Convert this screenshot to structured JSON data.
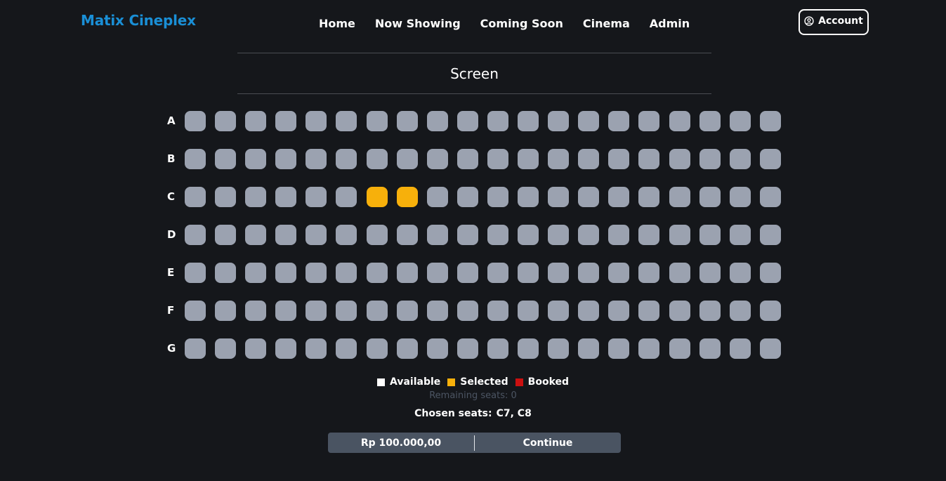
{
  "header": {
    "brand": "Matix Cineplex",
    "nav": [
      "Home",
      "Now Showing",
      "Coming Soon",
      "Cinema",
      "Admin"
    ],
    "account_label": "Account"
  },
  "screen_label": "Screen",
  "seats": {
    "rows": [
      "A",
      "B",
      "C",
      "D",
      "E",
      "F",
      "G"
    ],
    "seats_per_row": 20,
    "selected": [
      "C7",
      "C8"
    ],
    "booked": []
  },
  "legend": {
    "available": "Available",
    "selected": "Selected",
    "booked": "Booked",
    "colors": {
      "available": "#ffffff",
      "selected": "#f7b00b",
      "booked": "#cc1010",
      "seat": "#9ba2b0"
    }
  },
  "remaining_text": "Remaining seats: 0",
  "chosen": {
    "label": "Chosen seats:",
    "value": "C7, C8"
  },
  "checkout": {
    "price": "Rp 100.000,00",
    "continue_label": "Continue"
  }
}
